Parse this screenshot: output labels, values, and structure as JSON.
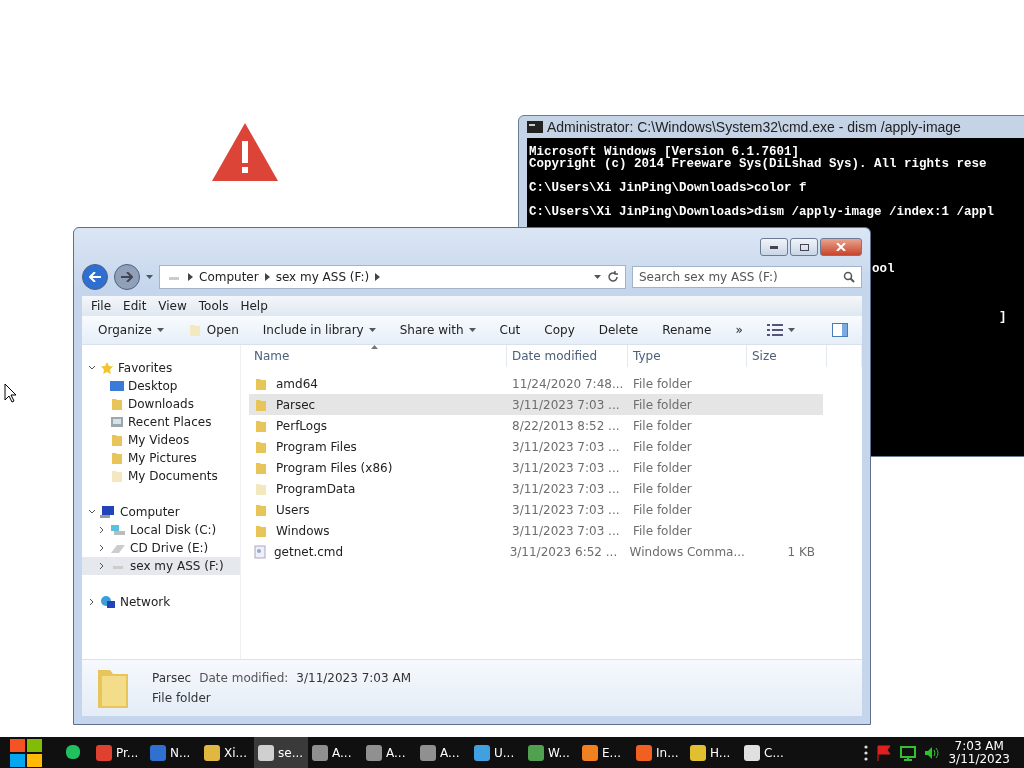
{
  "cmd_window": {
    "title": "Administrator: C:\\Windows\\System32\\cmd.exe - dism  /apply-image",
    "blocks": [
      [
        "Microsoft Windows [Version 6.1.7601]",
        "Copyright (c) 2014 Freeware Sys(DiLshad Sys).  All rights rese"
      ],
      [
        "C:\\Users\\Xi JinPing\\Downloads>color f"
      ],
      [
        "C:\\Users\\Xi JinPing\\Downloads>dism /apply-image /index:1 /appl"
      ]
    ],
    "fragments": [
      "ool",
      "]"
    ]
  },
  "explorer": {
    "breadcrumb": [
      "Computer",
      "sex my ASS (F:)"
    ],
    "search": {
      "placeholder": "Search sex my ASS (F:)"
    },
    "menu": [
      "File",
      "Edit",
      "View",
      "Tools",
      "Help"
    ],
    "toolbar": [
      {
        "label": "Organize",
        "kind": "dropdown"
      },
      {
        "label": "Open",
        "kind": "icon"
      },
      {
        "label": "Include in library",
        "kind": "dropdown"
      },
      {
        "label": "Share with",
        "kind": "dropdown"
      },
      {
        "label": "Cut",
        "kind": "plain"
      },
      {
        "label": "Copy",
        "kind": "plain"
      },
      {
        "label": "Delete",
        "kind": "plain"
      },
      {
        "label": "Rename",
        "kind": "plain"
      },
      {
        "label": "»",
        "kind": "plain"
      }
    ],
    "nav": [
      {
        "label": "Favorites",
        "kind": "star",
        "expanded": true,
        "selected": false,
        "children": [
          {
            "label": "Desktop",
            "kind": "desktop",
            "selected": false
          },
          {
            "label": "Downloads",
            "kind": "folder",
            "selected": false
          },
          {
            "label": "Recent Places",
            "kind": "recent",
            "selected": false
          },
          {
            "label": "My Videos",
            "kind": "folder",
            "selected": false
          },
          {
            "label": "My Pictures",
            "kind": "folder",
            "selected": false
          },
          {
            "label": "My Documents",
            "kind": "doc",
            "selected": false
          }
        ]
      },
      {
        "label": "Computer",
        "kind": "computer",
        "expanded": true,
        "selected": false,
        "children": [
          {
            "label": "Local Disk (C:)",
            "kind": "disk",
            "expanded": false,
            "selected": false
          },
          {
            "label": "CD Drive (E:)",
            "kind": "cd",
            "expanded": false,
            "selected": false
          },
          {
            "label": "sex my ASS (F:)",
            "kind": "drive",
            "expanded": false,
            "selected": true
          }
        ]
      },
      {
        "label": "Network",
        "kind": "network",
        "expanded": false,
        "selected": false
      }
    ],
    "columns": [
      "Name",
      "Date modified",
      "Type",
      "Size"
    ],
    "rows": [
      {
        "name": "amd64",
        "date": "11/24/2020 7:48...",
        "type": "File folder",
        "kind": "folder",
        "selected": false
      },
      {
        "name": "Parsec",
        "date": "3/11/2023 7:03 ...",
        "type": "File folder",
        "kind": "folder",
        "selected": true
      },
      {
        "name": "PerfLogs",
        "date": "8/22/2013 8:52 ...",
        "type": "File folder",
        "kind": "folder",
        "selected": false
      },
      {
        "name": "Program Files",
        "date": "3/11/2023 7:03 ...",
        "type": "File folder",
        "kind": "folder",
        "selected": false
      },
      {
        "name": "Program Files (x86)",
        "date": "3/11/2023 7:03 ...",
        "type": "File folder",
        "kind": "folder",
        "selected": false
      },
      {
        "name": "ProgramData",
        "date": "3/11/2023 7:03 ...",
        "type": "File folder",
        "kind": "folder",
        "selected": false
      },
      {
        "name": "Users",
        "date": "3/11/2023 7:03 ...",
        "type": "File folder",
        "kind": "folder",
        "selected": false
      },
      {
        "name": "Windows",
        "date": "3/11/2023 7:03 ...",
        "type": "File folder",
        "kind": "folder",
        "selected": false
      },
      {
        "name": "getnet.cmd",
        "date": "3/11/2023 6:52 ...",
        "type": "Windows Comma...",
        "size": "1 KB",
        "kind": "file",
        "selected": false
      }
    ],
    "details": {
      "name": "Parsec",
      "date_label": "Date modified:",
      "date": "3/11/2023 7:03 AM",
      "type": "File folder"
    }
  },
  "taskbar": {
    "items": [
      {
        "label": "Pr...",
        "color": "#e04030",
        "selected": false
      },
      {
        "label": "N...",
        "color": "#3070d0",
        "selected": false
      },
      {
        "label": "Xi...",
        "color": "#e0b840",
        "selected": false
      },
      {
        "label": "se...",
        "color": "#d0d0d0",
        "selected": true
      },
      {
        "label": "A...",
        "color": "#909090",
        "selected": false
      },
      {
        "label": "A...",
        "color": "#909090",
        "selected": false
      },
      {
        "label": "A...",
        "color": "#909090",
        "selected": false
      },
      {
        "label": "U...",
        "color": "#40a0e0",
        "selected": false
      },
      {
        "label": "W...",
        "color": "#50a050",
        "selected": false
      },
      {
        "label": "E...",
        "color": "#f08020",
        "selected": false
      },
      {
        "label": "In...",
        "color": "#f06020",
        "selected": false
      },
      {
        "label": "H...",
        "color": "#e0c030",
        "selected": false
      },
      {
        "label": "C...",
        "color": "#e0e0e0",
        "selected": false
      }
    ],
    "time": "7:03 AM",
    "date": "3/11/2023"
  }
}
